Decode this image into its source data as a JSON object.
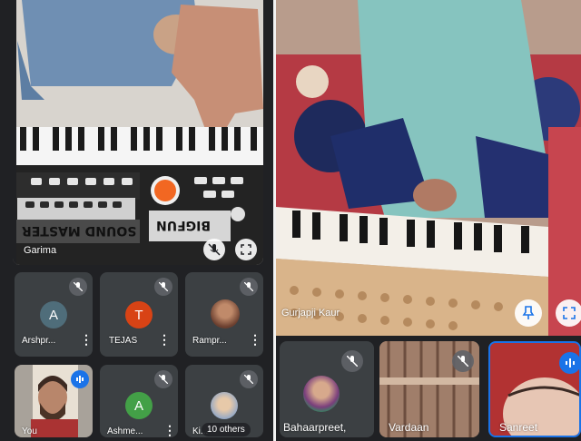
{
  "left_panel": {
    "main_participant": {
      "name": "Garima"
    },
    "keyboard_brand": "SOUND MASTER",
    "keyboard_model": "BIGFUN",
    "tiles": [
      {
        "name": "Arshpr...",
        "initial": "A",
        "avatar_color": "#4f6d7a"
      },
      {
        "name": "TEJAS",
        "initial": "T",
        "avatar_color": "#d84315"
      },
      {
        "name": "Rampr...",
        "initial": "",
        "avatar_color": "#8d5a4a"
      },
      {
        "name": "You",
        "initial": "",
        "avatar_color": "#5d4037"
      },
      {
        "name": "Ashme...",
        "initial": "A",
        "avatar_color": "#43a047"
      },
      {
        "name": "Ki...",
        "initial": "",
        "avatar_color": "#c9b29a"
      }
    ],
    "others_label": "10 others"
  },
  "right_panel": {
    "main_participant": {
      "name": "Gurjapji Kaur"
    },
    "tiles": [
      {
        "name": "Bahaarpreet,"
      },
      {
        "name": "Vardaan"
      },
      {
        "name": "Sanreet"
      }
    ]
  },
  "colors": {
    "meet_dark": "#202124",
    "tile": "#3c4043",
    "mic_off_bg": "#5f6368",
    "accent_blue": "#1a73e8"
  },
  "icons": {
    "mic_off": "mic-off-icon",
    "fullscreen": "fullscreen-icon",
    "pin": "pin-icon",
    "more": "more-vert-icon",
    "audio": "audio-level-icon"
  }
}
